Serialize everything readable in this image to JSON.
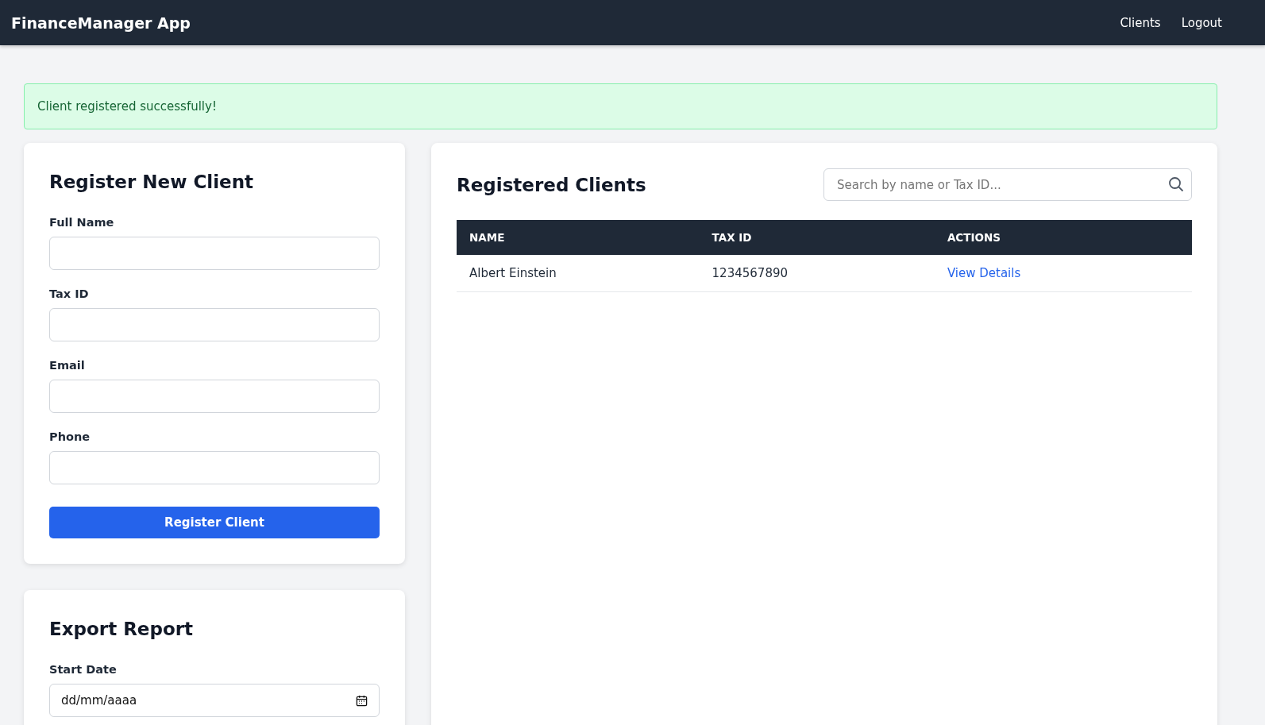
{
  "navbar": {
    "brand": "FinanceManager App",
    "links": [
      "Clients",
      "Logout"
    ]
  },
  "alert": {
    "message": "Client registered successfully!"
  },
  "register_form": {
    "title": "Register New Client",
    "fields": [
      {
        "label": "Full Name"
      },
      {
        "label": "Tax ID"
      },
      {
        "label": "Email"
      },
      {
        "label": "Phone"
      }
    ],
    "button": "Register Client"
  },
  "export_report": {
    "title": "Export Report",
    "fields": [
      {
        "label": "Start Date",
        "placeholder": "dd/mm/aaaa"
      }
    ]
  },
  "clients": {
    "title": "Registered Clients",
    "search": {
      "placeholder": "Search by name or Tax ID..."
    },
    "table": {
      "columns": [
        "NAME",
        "TAX ID",
        "ACTIONS"
      ],
      "rows": [
        {
          "name": "Albert Einstein",
          "tax_id": "1234567890",
          "action": "View Details"
        }
      ]
    }
  }
}
